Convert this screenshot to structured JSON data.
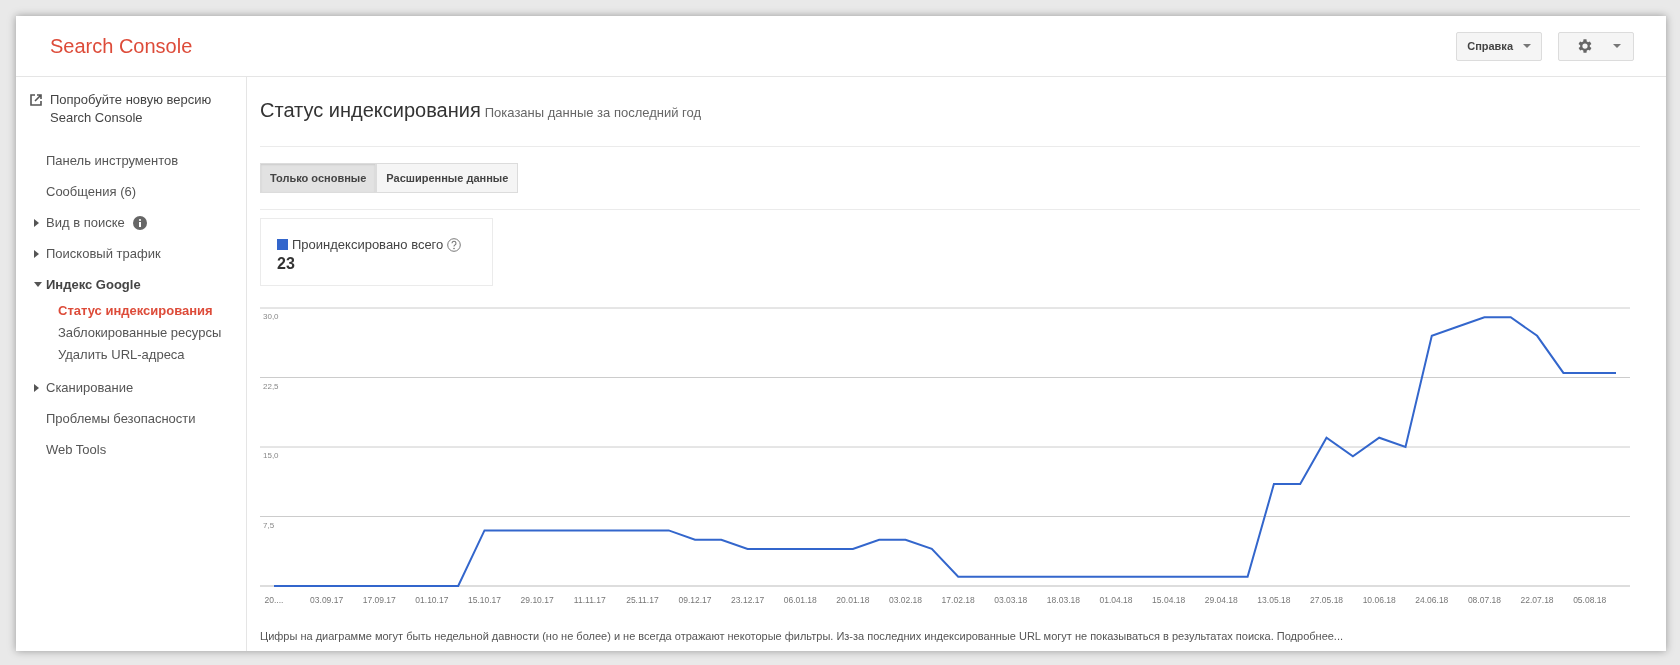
{
  "header": {
    "title": "Search Console",
    "help_button": "Справка"
  },
  "sidebar": {
    "promo": "Попробуйте новую версию Search Console",
    "items": [
      {
        "label": "Панель инструментов",
        "kind": "link"
      },
      {
        "label": "Сообщения (6)",
        "kind": "link"
      },
      {
        "label": "Вид в поиске",
        "kind": "group",
        "expanded": false,
        "info": true
      },
      {
        "label": "Поисковый трафик",
        "kind": "group",
        "expanded": false
      },
      {
        "label": "Индекс Google",
        "kind": "group",
        "expanded": true,
        "children": [
          {
            "label": "Статус индексирования",
            "selected": true
          },
          {
            "label": "Заблокированные ресурсы",
            "selected": false
          },
          {
            "label": "Удалить URL-адреса",
            "selected": false
          }
        ]
      },
      {
        "label": "Сканирование",
        "kind": "group",
        "expanded": false
      },
      {
        "label": "Проблемы безопасности",
        "kind": "link"
      },
      {
        "label": "Web Tools",
        "kind": "link"
      }
    ]
  },
  "page": {
    "title": "Статус индексирования",
    "subtitle": "Показаны данные за последний год",
    "tabs": [
      {
        "label": "Только основные",
        "selected": true
      },
      {
        "label": "Расширенные данные",
        "selected": false
      }
    ],
    "metric": {
      "label": "Проиндексировано всего",
      "value": "23",
      "color": "#3366cc"
    },
    "chart_data": {
      "type": "line",
      "categories": [
        "20....",
        null,
        "03.09.17",
        null,
        "17.09.17",
        null,
        "01.10.17",
        null,
        "15.10.17",
        null,
        "29.10.17",
        null,
        "11.11.17",
        null,
        "25.11.17",
        null,
        "09.12.17",
        null,
        "23.12.17",
        null,
        "06.01.18",
        null,
        "20.01.18",
        null,
        "03.02.18",
        null,
        "17.02.18",
        null,
        "03.03.18",
        null,
        "18.03.18",
        null,
        "01.04.18",
        null,
        "15.04.18",
        null,
        "29.04.18",
        null,
        "13.05.18",
        null,
        "27.05.18",
        null,
        "10.06.18",
        null,
        "24.06.18",
        null,
        "08.07.18",
        null,
        "22.07.18",
        null,
        "05.08.18",
        null
      ],
      "series": [
        {
          "color": "#3366cc",
          "values": [
            0,
            0,
            0,
            0,
            0,
            0,
            0,
            0,
            6,
            6,
            6,
            6,
            6,
            6,
            6,
            6,
            5,
            5,
            4,
            4,
            4,
            4,
            4,
            5,
            5,
            4,
            1,
            1,
            1,
            1,
            1,
            1,
            1,
            1,
            1,
            1,
            1,
            1,
            11,
            11,
            16,
            14,
            16,
            15,
            27,
            28,
            29,
            29,
            27,
            23,
            23,
            23
          ]
        }
      ],
      "ylim": [
        0,
        30
      ],
      "grid": true,
      "yticks": [
        {
          "value": 7.5,
          "label": "7,5"
        },
        {
          "value": 15,
          "label": "15,0"
        },
        {
          "value": 22.5,
          "label": "22,5"
        },
        {
          "value": 30,
          "label": "30,0"
        }
      ]
    },
    "footnote": "Цифры на диаграмме могут быть недельной давности (но не более) и не всегда отражают некоторые фильтры. Из-за последних индексированные URL могут не показываться в результатах поиска. Подробнее..."
  }
}
